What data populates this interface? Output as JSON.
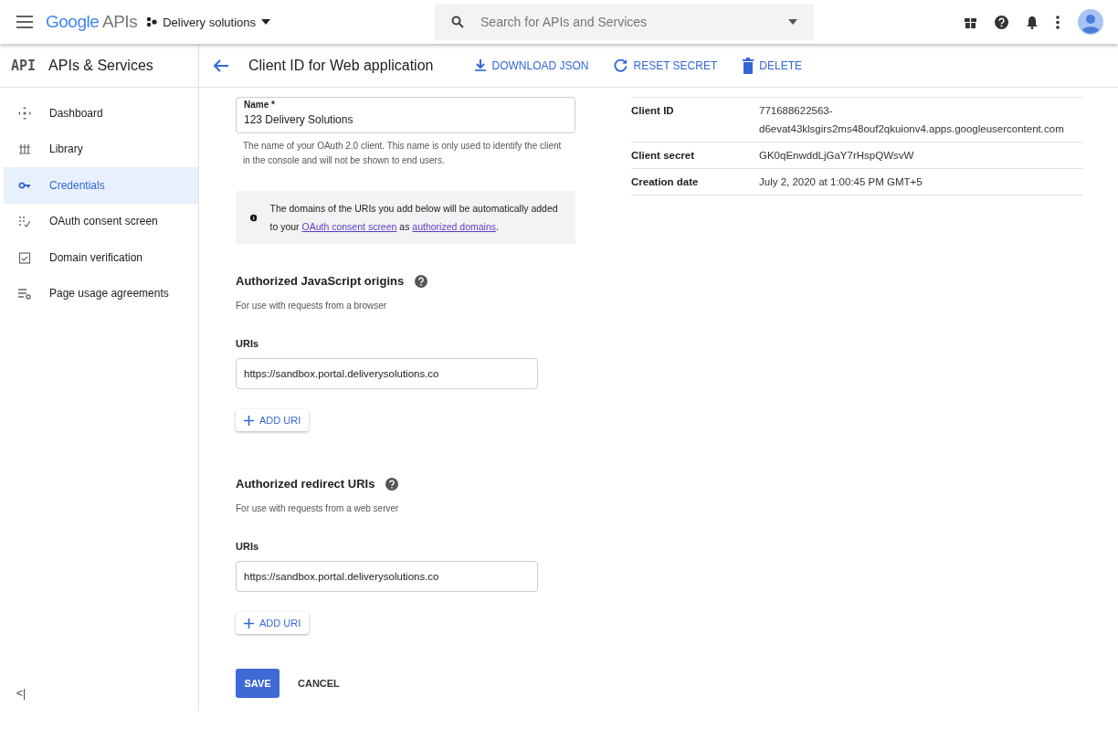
{
  "topbar": {
    "logo_brand": "Google",
    "logo_product": "APIs",
    "project": "Delivery solutions",
    "search": {
      "placeholder": "Search for APIs and Services"
    }
  },
  "sidebar": {
    "logo": "API",
    "title": "APIs & Services",
    "items": [
      {
        "label": "Dashboard",
        "selected": false
      },
      {
        "label": "Library",
        "selected": false
      },
      {
        "label": "Credentials",
        "selected": true
      },
      {
        "label": "OAuth consent screen",
        "selected": false
      },
      {
        "label": "Domain verification",
        "selected": false
      },
      {
        "label": "Page usage agreements",
        "selected": false
      }
    ],
    "collapse": "<|"
  },
  "header": {
    "title": "Client ID for Web application",
    "actions": [
      {
        "label": "DOWNLOAD JSON"
      },
      {
        "label": "RESET SECRET"
      },
      {
        "label": "DELETE"
      }
    ]
  },
  "name_field": {
    "label": "Name *",
    "value": "123 Delivery Solutions",
    "hint": "The name of your OAuth 2.0 client. This name is only used to identify the client in the console and will not be shown to end users."
  },
  "info": {
    "before": "The domains of the URIs you add below will be automatically added to your ",
    "link_1": "OAuth consent screen",
    "middle": " as ",
    "link_2": "authorized domains",
    "after": "."
  },
  "sections": [
    {
      "title": "Authorized JavaScript origins",
      "subtitle": "For use with requests from a browser",
      "uris_label": "URIs",
      "uri": "https://sandbox.portal.deliverysolutions.co",
      "add_button": "ADD URI"
    },
    {
      "title": "Authorized redirect URIs",
      "subtitle": "For use with requests from a web server",
      "uris_label": "URIs",
      "uri": "https://sandbox.portal.deliverysolutions.co",
      "add_button": "ADD URI"
    }
  ],
  "buttons": {
    "save": "SAVE",
    "cancel": "CANCEL"
  },
  "details": [
    {
      "label": "Client ID",
      "value_lines": [
        "771688622563-",
        "d6evat43klsgirs2ms48ouf2qkuionv4.apps.googleusercontent.com"
      ]
    },
    {
      "label": "Client secret",
      "value_lines": [
        "GK0qEnwddLjGaY7rHspQWsvW"
      ]
    },
    {
      "label": "Creation date",
      "value_lines": [
        "July 2, 2020 at 1:00:45 PM GMT+5"
      ]
    }
  ]
}
